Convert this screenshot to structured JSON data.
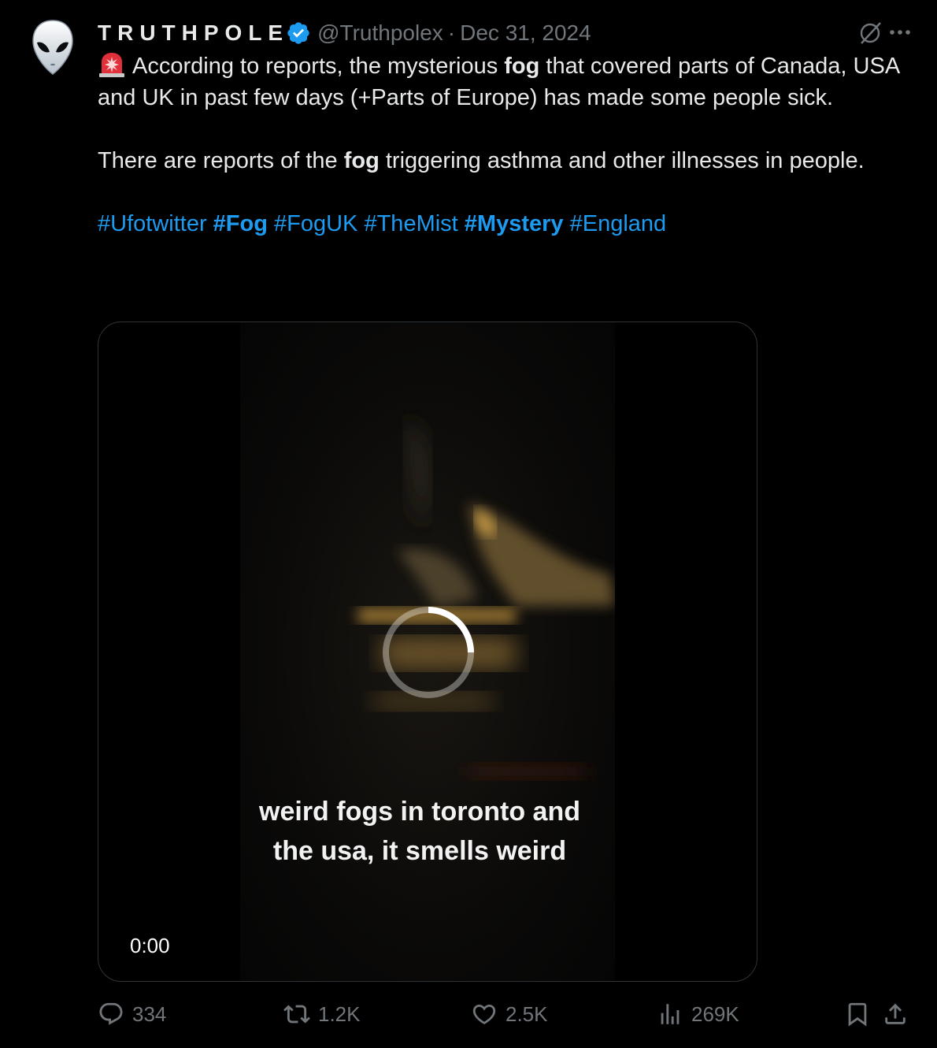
{
  "author": {
    "display_name": "TRUTHPOLE",
    "handle": "@Truthpolex",
    "separator": "·",
    "date": "Dec 31, 2024",
    "avatar_icon": "alien-head-icon",
    "verified_color": "#1d9bf0"
  },
  "tweet": {
    "line1_pre": "According to reports, the mysterious ",
    "line1_bold": "fog",
    "line1_post": " that covered parts of Canada, USA and UK in past few days (+Parts of Europe) has made some people sick.",
    "line2_pre": "There are reports of the ",
    "line2_bold": "fog",
    "line2_post": " triggering asthma and other illnesses in people.",
    "hashtags": [
      "#Ufotwitter",
      "#Fog",
      "#FogUK",
      "#TheMist",
      "#Mystery",
      "#England"
    ]
  },
  "media": {
    "caption_line1": "weird fogs in toronto and",
    "caption_line2": "the usa, it smells weird",
    "timestamp": "0:00"
  },
  "actions": {
    "replies": "334",
    "reposts": "1.2K",
    "likes": "2.5K",
    "views": "269K"
  },
  "colors": {
    "background": "#000000",
    "text": "#e7e9ea",
    "muted": "#71767b",
    "link": "#1d9bf0"
  }
}
